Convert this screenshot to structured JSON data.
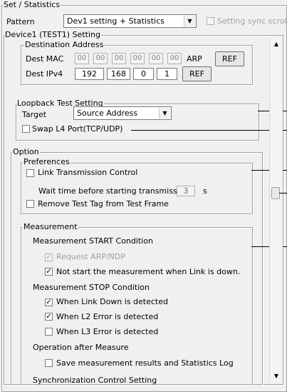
{
  "set_statistics": {
    "title": "Set / Statistics",
    "pattern_label": "Pattern",
    "pattern_value": "Dev1 setting + Statistics",
    "sync_scroll_label": "Setting sync scroll"
  },
  "device": {
    "title": "Device1 (TEST1) Setting",
    "destination": {
      "title": "Destination Address",
      "mac_label": "Dest MAC",
      "mac_octets": [
        "00",
        "00",
        "00",
        "00",
        "00",
        "00"
      ],
      "arp_label": "ARP",
      "ref_label": "REF",
      "ipv4_label": "Dest IPv4",
      "ipv4_octets": [
        "192",
        "168",
        "0",
        "1"
      ],
      "ref2_label": "REF"
    },
    "loopback": {
      "title": "Loopback Test Setting",
      "target_label": "Target",
      "target_value": "Source Address",
      "swap_label": "Swap L4 Port(TCP/UDP)"
    },
    "option": {
      "title": "Option",
      "preferences": {
        "title": "Preferences",
        "link_tx_label": "Link Transmission Control",
        "wait_label": "Wait time before starting transmission",
        "wait_value": "3",
        "wait_unit": "s",
        "remove_tag_label": "Remove Test Tag from Test Frame"
      },
      "measurement": {
        "title": "Measurement",
        "start_heading": "Measurement START Condition",
        "request_arp_label": "Request ARP/NDP",
        "not_start_label": "Not start the measurement when Link is down.",
        "stop_heading": "Measurement STOP Condition",
        "link_down_label": "When Link Down is detected",
        "l2_error_label": "When L2 Error is detected",
        "l3_error_label": "When L3 Error is detected",
        "after_heading": "Operation after Measure",
        "save_results_label": "Save measurement results and Statistics Log",
        "sync_control_label": "Synchronization Control Setting"
      }
    }
  },
  "checks": {
    "sync_scroll": false,
    "swap_l4": false,
    "link_tx": false,
    "remove_tag": false,
    "request_arp": true,
    "not_start": true,
    "link_down": true,
    "l2_error": true,
    "l3_error": false,
    "save_results": false
  },
  "icons": {
    "checkmark": "checkmark-icon",
    "dropdown": "chevron-down-icon",
    "scroll_up": "scroll-up-arrow-icon",
    "scroll_down": "scroll-down-arrow-icon"
  }
}
